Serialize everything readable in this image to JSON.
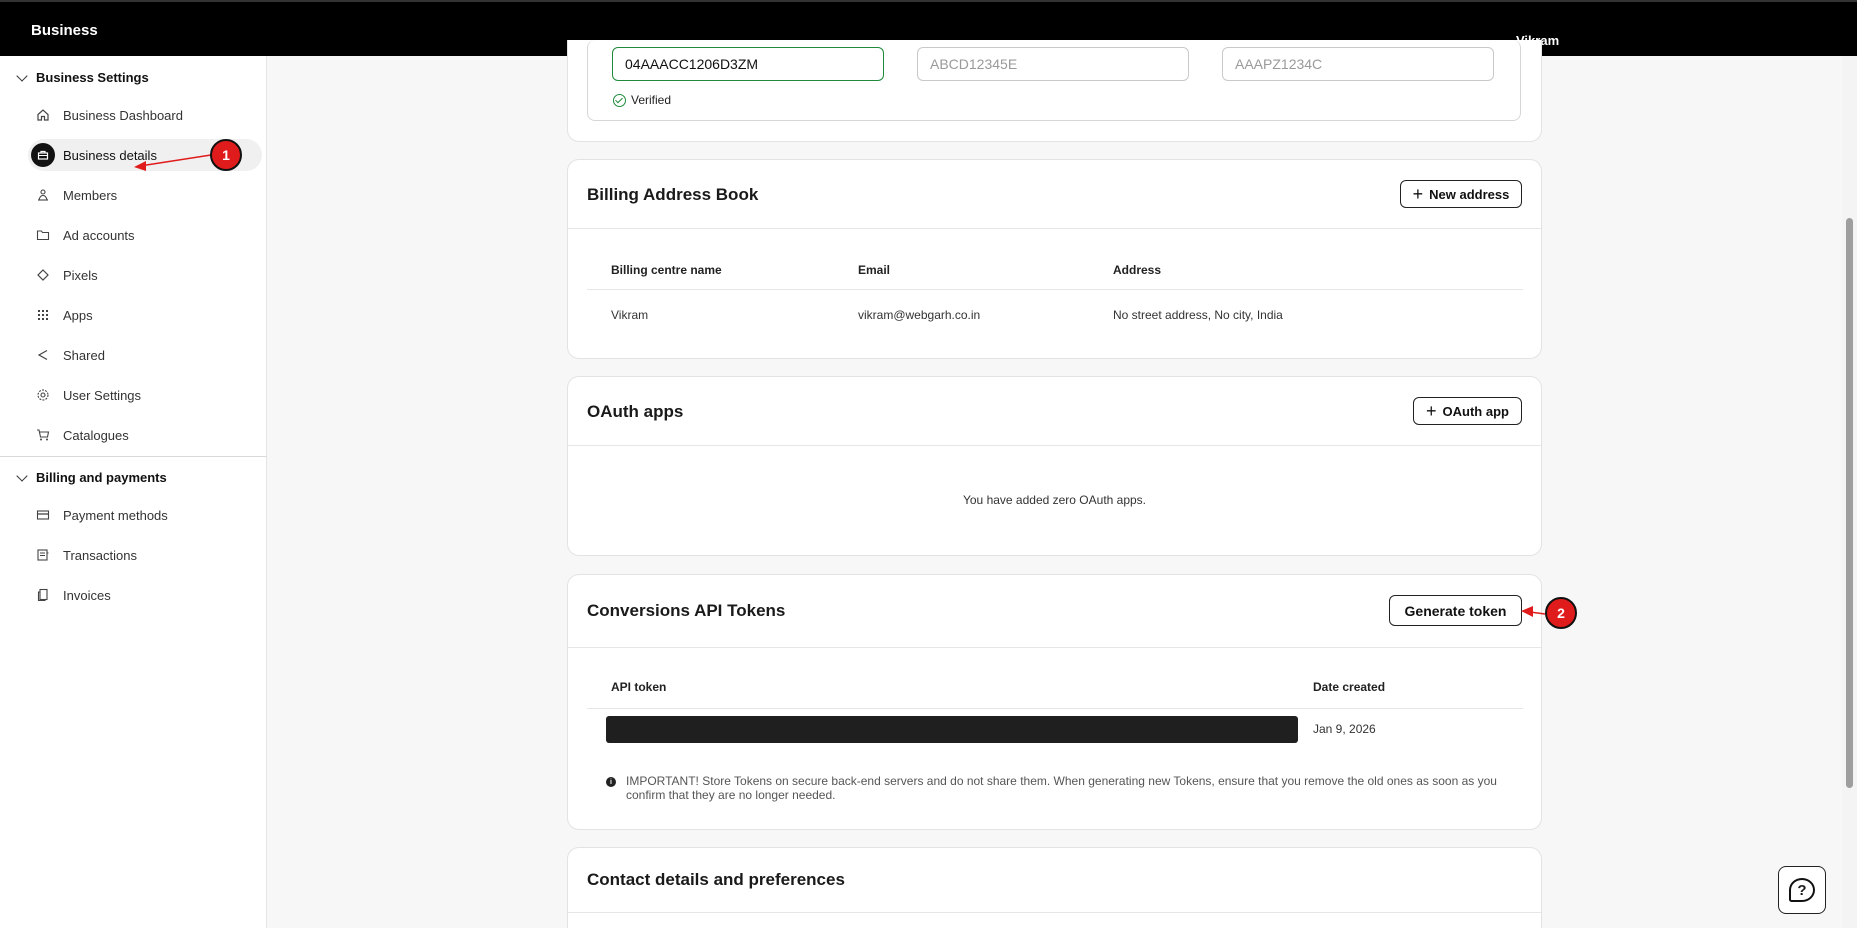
{
  "topbar": {
    "brand": "Business",
    "user": "Vikram"
  },
  "sidebar": {
    "group1": "Business Settings",
    "items1": [
      {
        "label": "Business Dashboard",
        "icon": "home-icon"
      },
      {
        "label": "Business details",
        "icon": "briefcase-icon"
      },
      {
        "label": "Members",
        "icon": "members-icon"
      },
      {
        "label": "Ad accounts",
        "icon": "folder-icon"
      },
      {
        "label": "Pixels",
        "icon": "diamond-icon"
      },
      {
        "label": "Apps",
        "icon": "apps-grid-icon"
      },
      {
        "label": "Shared",
        "icon": "share-icon"
      },
      {
        "label": "User Settings",
        "icon": "gear-icon"
      },
      {
        "label": "Catalogues",
        "icon": "cart-icon"
      }
    ],
    "group2": "Billing and payments",
    "items2": [
      {
        "label": "Payment methods",
        "icon": "card-icon"
      },
      {
        "label": "Transactions",
        "icon": "receipt-icon"
      },
      {
        "label": "Invoices",
        "icon": "invoice-icon"
      }
    ]
  },
  "tax": {
    "gst_value": "04AAACC1206D3ZM",
    "gst_status": "Verified",
    "pan_placeholder": "ABCD12345E",
    "tan_placeholder": "AAAPZ1234C"
  },
  "billing": {
    "title": "Billing Address Book",
    "new_button": "New address",
    "columns": [
      "Billing centre name",
      "Email",
      "Address"
    ],
    "row": [
      "Vikram",
      "vikram@webgarh.co.in",
      "No street address, No city, India"
    ]
  },
  "oauth": {
    "title": "OAuth apps",
    "button": "OAuth app",
    "empty": "You have added zero OAuth apps."
  },
  "tokens": {
    "title": "Conversions API Tokens",
    "button": "Generate token",
    "columns": [
      "API token",
      "Date created"
    ],
    "token_date": "Jan 9, 2026",
    "notice": "IMPORTANT! Store Tokens on secure back-end servers and do not share them. When generating new Tokens, ensure that you remove the old ones as soon as you confirm that they are no longer needed."
  },
  "contact": {
    "title": "Contact details and preferences"
  },
  "annotations": [
    "1",
    "2"
  ]
}
